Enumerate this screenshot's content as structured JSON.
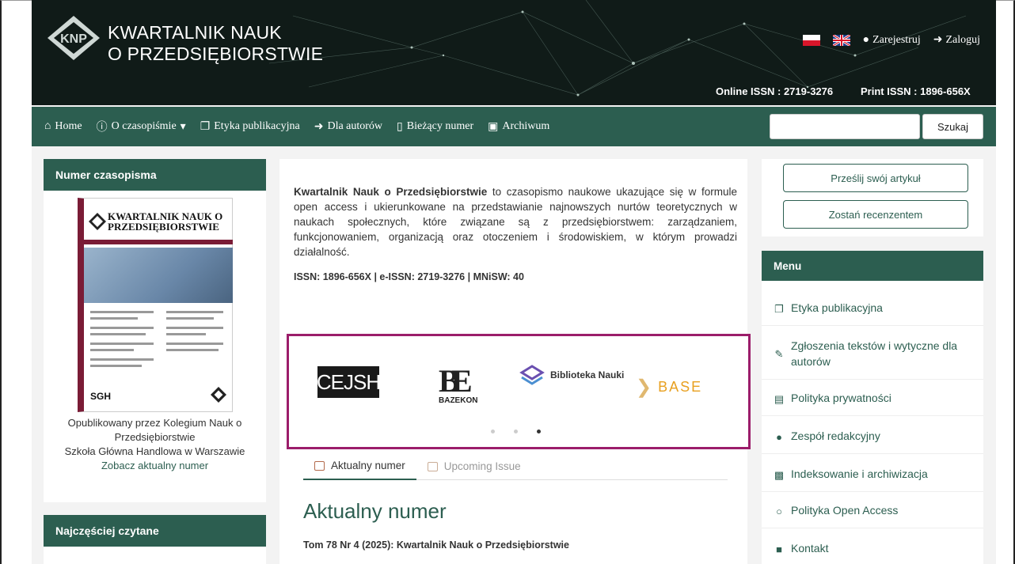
{
  "header": {
    "title_line1": "KWARTALNIK NAUK",
    "title_line2": "O PRZEDSIĘBIORSTWIE",
    "register": "Zarejestruj",
    "login": "Zaloguj",
    "online_issn": "Online ISSN : 2719-3276",
    "print_issn": "Print ISSN : 1896-656X"
  },
  "nav": {
    "items": [
      "Home",
      "O czasopiśmie",
      "Etyka publikacyjna",
      "Dla autorów",
      "Bieżący numer",
      "Archiwum"
    ],
    "search_placeholder": "",
    "search_button": "Szukaj"
  },
  "left": {
    "panel_title": "Numer czasopisma",
    "cover_title": "KWARTALNIK NAUK O PRZEDSIĘBIORSTWIE",
    "cover_publisher": "SGH",
    "published_by_1": "Opublikowany przez Kolegium Nauk o",
    "published_by_2": "Przedsiębiorstwie",
    "published_by_3": "Szkoła Główna Handlowa w Warszawie",
    "see_current": "Zobacz aktualny numer",
    "panel2_title": "Najczęściej czytane"
  },
  "center": {
    "intro_bold": "Kwartalnik Nauk o Przedsiębiorstwie",
    "intro_rest": " to czasopismo naukowe ukazujące się w formule open access i ukierunkowane na przedstawianie najnowszych nurtów teoretycznych w naukach społecznych, które związane są z przedsiębiorstwem: zarządzaniem, funkcjonowaniem, organizacją oraz otoczeniem i środowiskiem, w którym prowadzi działalność.",
    "issn_line": "ISSN: 1896-656X | e-ISSN: 2719-3276 | MNiSW: 40",
    "carousel": {
      "logos": [
        "CEJSH",
        "BAZEKON",
        "Biblioteka Nauki",
        "BASE"
      ],
      "active_dot": 3
    },
    "tabs": [
      "Aktualny numer",
      "Upcoming Issue"
    ],
    "current_heading": "Aktualny numer",
    "current_issue": "Tom 78 Nr 4 (2025): Kwartalnik Nauk o Przedsiębiorstwie"
  },
  "right": {
    "submit_button": "Prześlij swój artykuł",
    "reviewer_button": "Zostań recenzentem",
    "menu_title": "Menu",
    "menu_items": [
      {
        "icon": "copy-icon",
        "label": "Etyka publikacyjna"
      },
      {
        "icon": "edit-icon",
        "label": "Zgłoszenia tekstów i wytyczne dla autorów"
      },
      {
        "icon": "document-icon",
        "label": "Polityka prywatności"
      },
      {
        "icon": "users-icon",
        "label": "Zespół redakcyjny"
      },
      {
        "icon": "sitemap-icon",
        "label": "Indeksowanie i archiwizacja"
      },
      {
        "icon": "circle-icon",
        "label": "Polityka Open Access"
      },
      {
        "icon": "contact-icon",
        "label": "Kontakt"
      }
    ]
  },
  "colors": {
    "brand_green": "#2c5e50",
    "carousel_border": "#9b1d6a",
    "header_bg": "#0f1a17"
  }
}
